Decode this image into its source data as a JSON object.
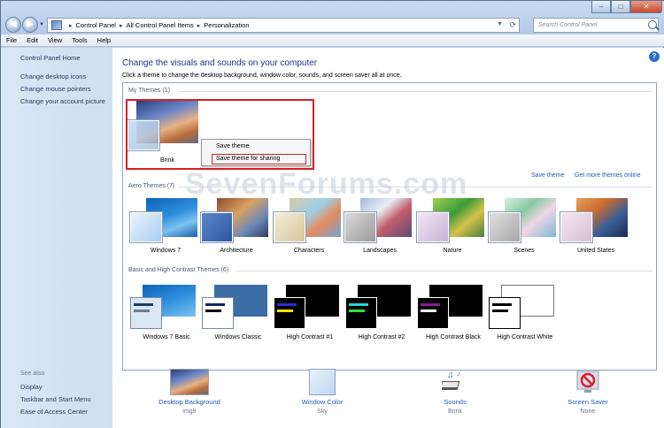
{
  "address_bar": {
    "crumbs": [
      "Control Panel",
      "All Control Panel Items",
      "Personalization"
    ]
  },
  "search": {
    "placeholder": "Search Control Panel"
  },
  "menubar": {
    "items": [
      "File",
      "Edit",
      "View",
      "Tools",
      "Help"
    ]
  },
  "left_pane": {
    "home": "Control Panel Home",
    "links": [
      "Change desktop icons",
      "Change mouse pointers",
      "Change your account picture"
    ],
    "see_also_heading": "See also",
    "see_also": [
      "Display",
      "Taskbar and Start Menu",
      "Ease of Access Center"
    ]
  },
  "main": {
    "title": "Change the visuals and sounds on your computer",
    "subtitle": "Click a theme to change the desktop background, window color, sounds, and screen saver all at once.",
    "my_themes_label": "My Themes (1)",
    "my_theme_name": "Brink",
    "save_theme_link": "Save theme",
    "get_more_link": "Get more themes online",
    "aero_label": "Aero Themes (7)",
    "aero_themes": [
      "Windows 7",
      "Architecture",
      "Characters",
      "Landscapes",
      "Nature",
      "Scenes",
      "United States"
    ],
    "basic_label": "Basic and High Contrast Themes (6)",
    "basic_themes": [
      "Windows 7 Basic",
      "Windows Classic",
      "High Contrast #1",
      "High Contrast #2",
      "High Contrast Black",
      "High Contrast White"
    ]
  },
  "context_menu": {
    "items": [
      "Save theme",
      "Save theme for sharing"
    ]
  },
  "bottom": {
    "desktop_background": {
      "title": "Desktop Background",
      "value": "img9"
    },
    "window_color": {
      "title": "Window Color",
      "value": "Sky"
    },
    "sounds": {
      "title": "Sounds",
      "value": "Brink"
    },
    "screen_saver": {
      "title": "Screen Saver",
      "value": "None"
    }
  },
  "watermark": "SevenForums.com",
  "colors": {
    "link": "#1c5bb4",
    "title": "#1e3287",
    "highlight": "#d61f26"
  }
}
